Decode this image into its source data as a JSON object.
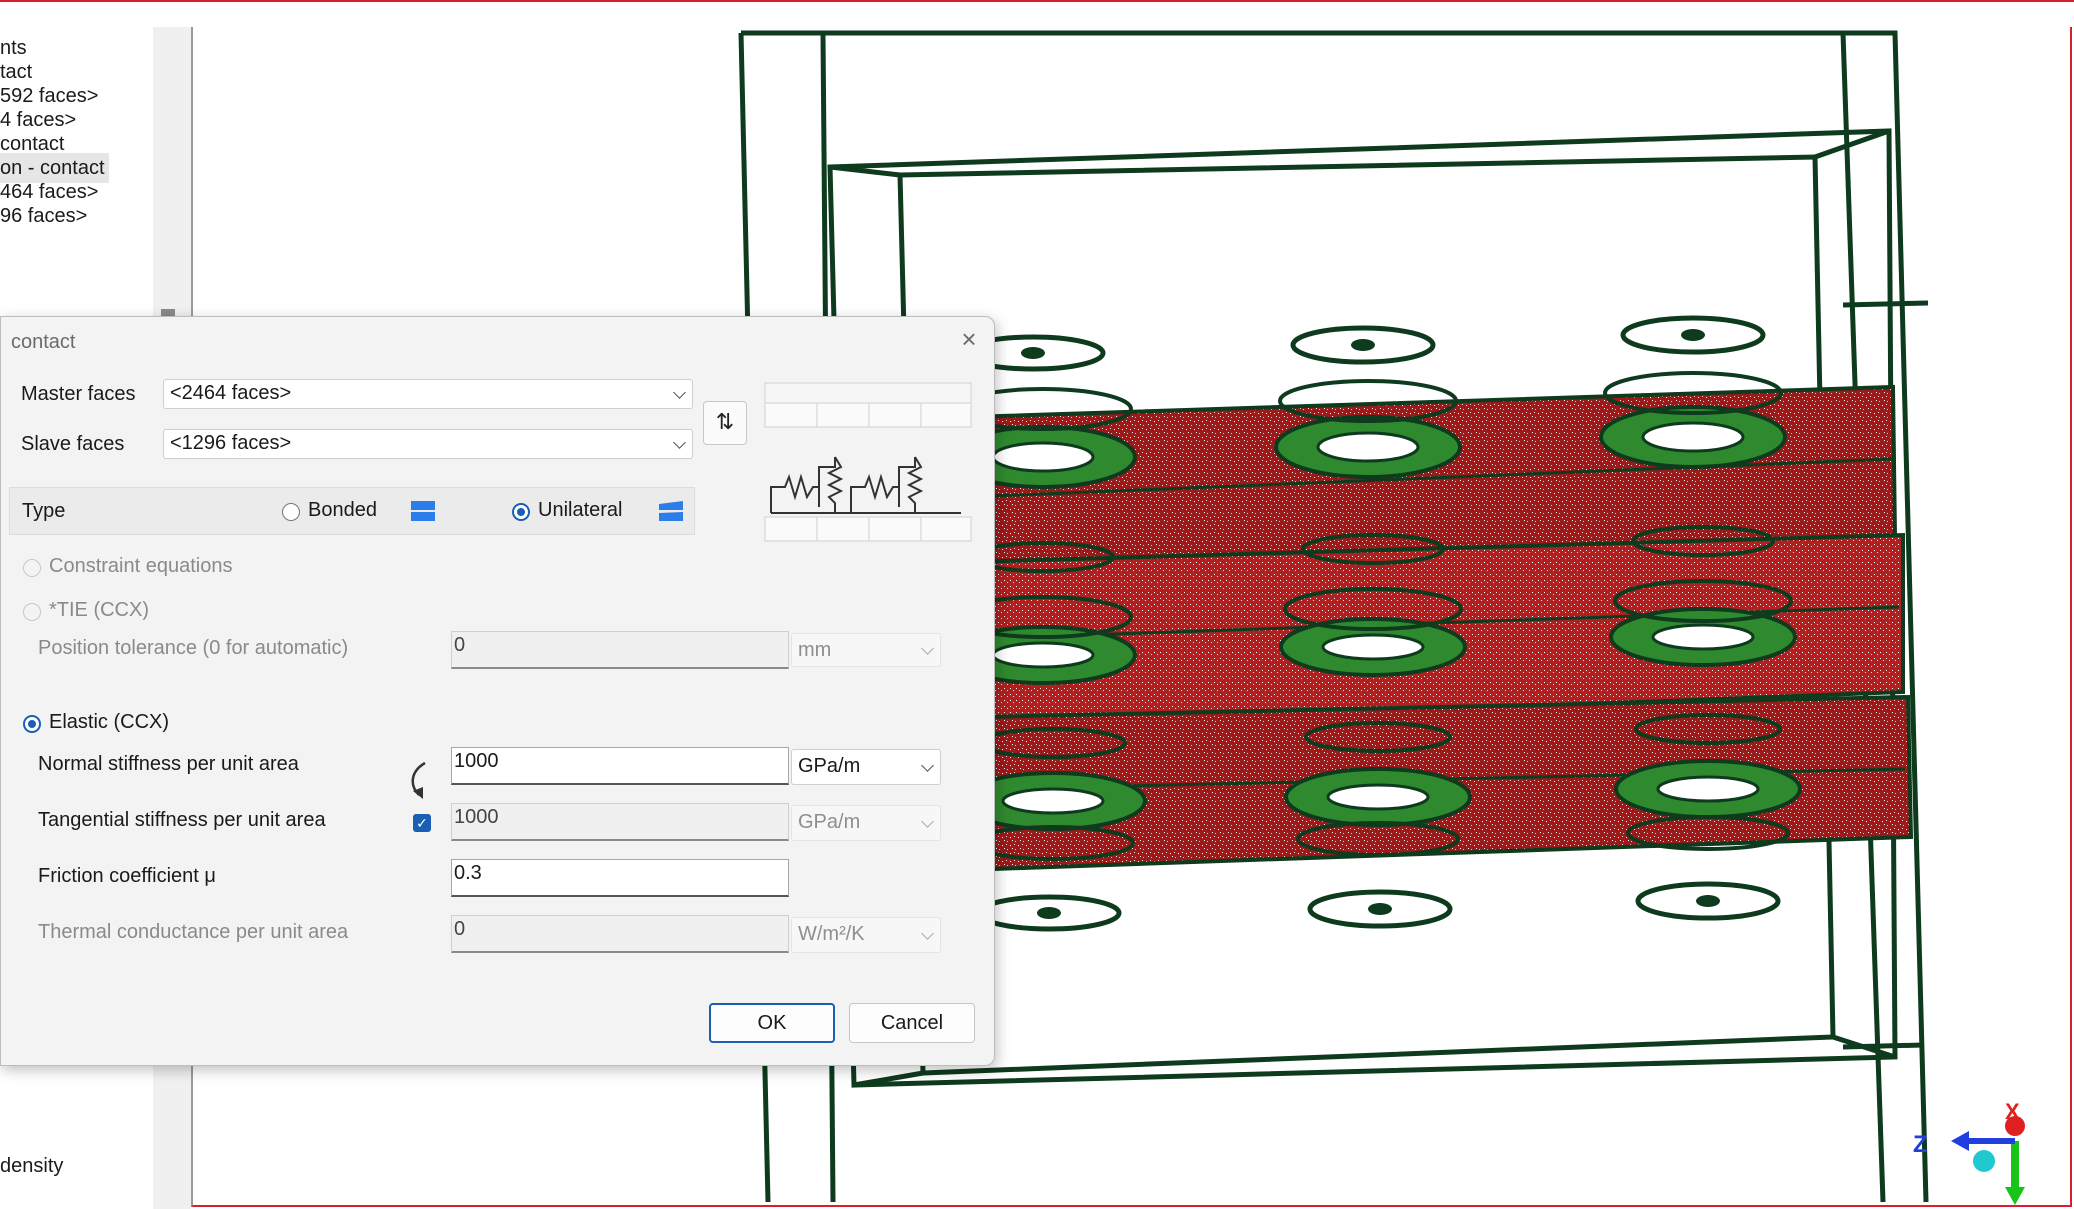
{
  "tree": {
    "items": [
      {
        "label": "nts"
      },
      {
        "label": "tact"
      },
      {
        "label": "592 faces>"
      },
      {
        "label": "4 faces>"
      },
      {
        "label": "contact"
      },
      {
        "label": "on - contact"
      },
      {
        "label": "464 faces>"
      },
      {
        "label": "96 faces>"
      },
      {
        "label": "density"
      }
    ]
  },
  "dialog": {
    "title": "contact",
    "close_glyph": "×",
    "master_faces": {
      "label": "Master faces",
      "value": "<2464 faces>"
    },
    "slave_faces": {
      "label": "Slave faces",
      "value": "<1296 faces>"
    },
    "swap_glyph": "⇅",
    "type": {
      "label": "Type",
      "bonded": "Bonded",
      "unilateral": "Unilateral",
      "selected": "Unilateral"
    },
    "constraint_equations": "Constraint equations",
    "tie": "*TIE (CCX)",
    "position_tolerance": {
      "label": "Position tolerance (0 for automatic)",
      "value": "0",
      "unit": "mm"
    },
    "elastic": "Elastic (CCX)",
    "normal_stiffness": {
      "label": "Normal stiffness per unit area",
      "value": "1000",
      "unit": "GPa/m"
    },
    "tangential_stiffness": {
      "label": "Tangential stiffness per unit area",
      "value": "1000",
      "unit": "GPa/m",
      "linked": true
    },
    "friction": {
      "label": "Friction coefficient μ",
      "value": "0.3"
    },
    "thermal": {
      "label": "Thermal conductance per unit area",
      "value": "0",
      "unit": "W/m²/K"
    },
    "ok": "OK",
    "cancel": "Cancel"
  },
  "axes": {
    "z": "Z",
    "x": "X"
  },
  "colors": {
    "accent": "#1a5fb4",
    "mesh_edge": "#0e3a1e",
    "mesh_red": "#9c1a1a",
    "mesh_green": "#2f8a2f",
    "window_border": "#d8202a"
  }
}
